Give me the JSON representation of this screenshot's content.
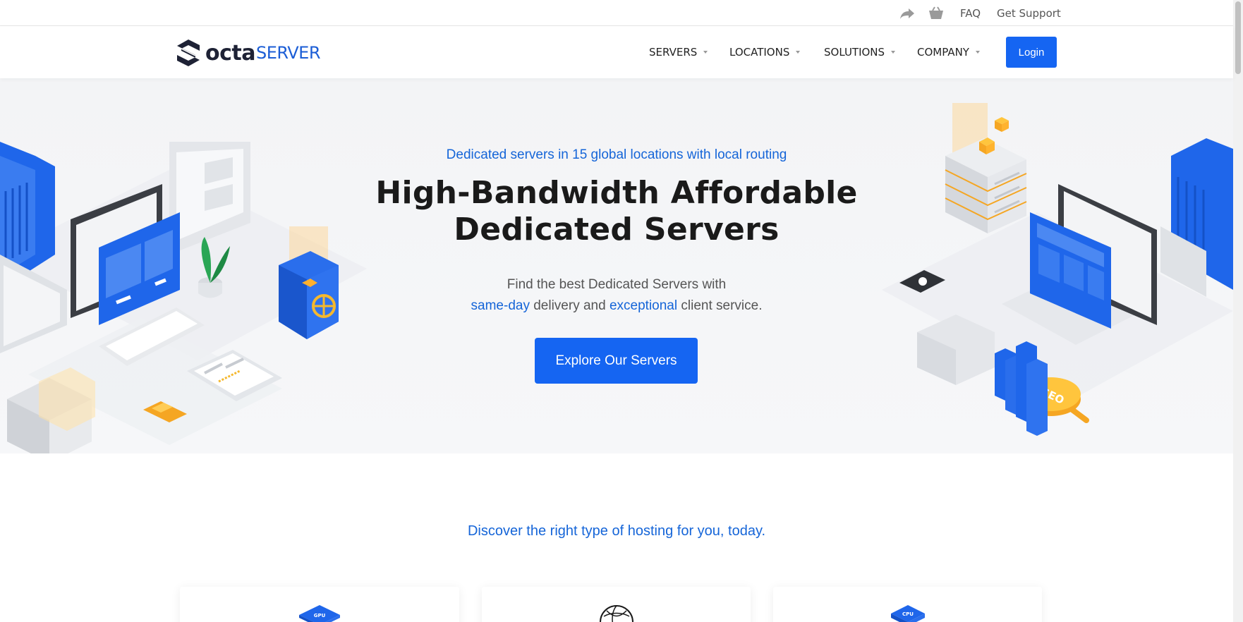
{
  "topbar": {
    "share_icon": "share-arrow-icon",
    "basket_icon": "basket-icon",
    "faq": "FAQ",
    "support": "Get Support"
  },
  "nav": {
    "logo_main": "octa",
    "logo_accent": "SERVER",
    "menu": [
      {
        "label": "SERVERS"
      },
      {
        "label": "LOCATIONS"
      },
      {
        "label": "SOLUTIONS"
      },
      {
        "label": "COMPANY"
      }
    ],
    "login": "Login"
  },
  "hero": {
    "eyebrow": "Dedicated servers in 15 global locations with local routing",
    "title_line1": "High-Bandwidth Affordable",
    "title_line2": "Dedicated Servers",
    "sub_line1": "Find the best Dedicated Servers with",
    "sub_hl1": "same-day",
    "sub_mid": " delivery and ",
    "sub_hl2": "exceptional",
    "sub_end": " client service.",
    "cta": "Explore Our Servers",
    "seo_badge": "SEO"
  },
  "discover": {
    "heading": "Discover the right type of hosting for you, today.",
    "cards": [
      {
        "icon": "server-chip-icon",
        "icon_label": "GPU"
      },
      {
        "icon": "globe-outline-icon"
      },
      {
        "icon": "cpu-chip-icon",
        "icon_label": "CPU"
      }
    ]
  },
  "colors": {
    "brand_blue": "#1565f2",
    "accent_text_blue": "#1565d8",
    "dark_text": "#1a1a1a",
    "logo_dark": "#1e2235"
  }
}
